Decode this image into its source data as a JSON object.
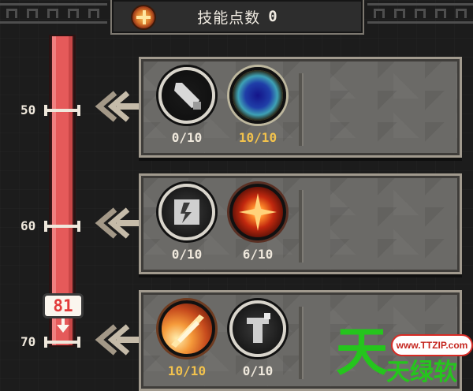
{
  "header": {
    "label": "技能点数",
    "value": "0",
    "emblem_icon": "cross-orb-icon"
  },
  "level_bar": {
    "current_level": 81,
    "marker_label": "81",
    "ticks": [
      {
        "label": "50"
      },
      {
        "label": "60"
      },
      {
        "label": "70"
      }
    ],
    "fill_color": "#e55a5a"
  },
  "tiers": [
    {
      "skills": [
        {
          "icon": "sword-icon",
          "level": "0/10",
          "state": "empty"
        },
        {
          "icon": "orb-icon",
          "level": "10/10",
          "state": "maxed"
        }
      ]
    },
    {
      "skills": [
        {
          "icon": "rune-icon",
          "level": "0/10",
          "state": "empty"
        },
        {
          "icon": "burst-icon",
          "level": "6/10",
          "state": "partial"
        }
      ]
    },
    {
      "skills": [
        {
          "icon": "slash-icon",
          "level": "10/10",
          "state": "maxed"
        },
        {
          "icon": "armor-icon",
          "level": "0/10",
          "state": "empty"
        }
      ]
    }
  ],
  "colors": {
    "maxed": "#f2c24d",
    "normal": "#efe8dc",
    "accent_red": "#e23b3b"
  },
  "watermark": {
    "big": "天",
    "pill": "www.TTZIP.com",
    "small": "天绿软"
  }
}
